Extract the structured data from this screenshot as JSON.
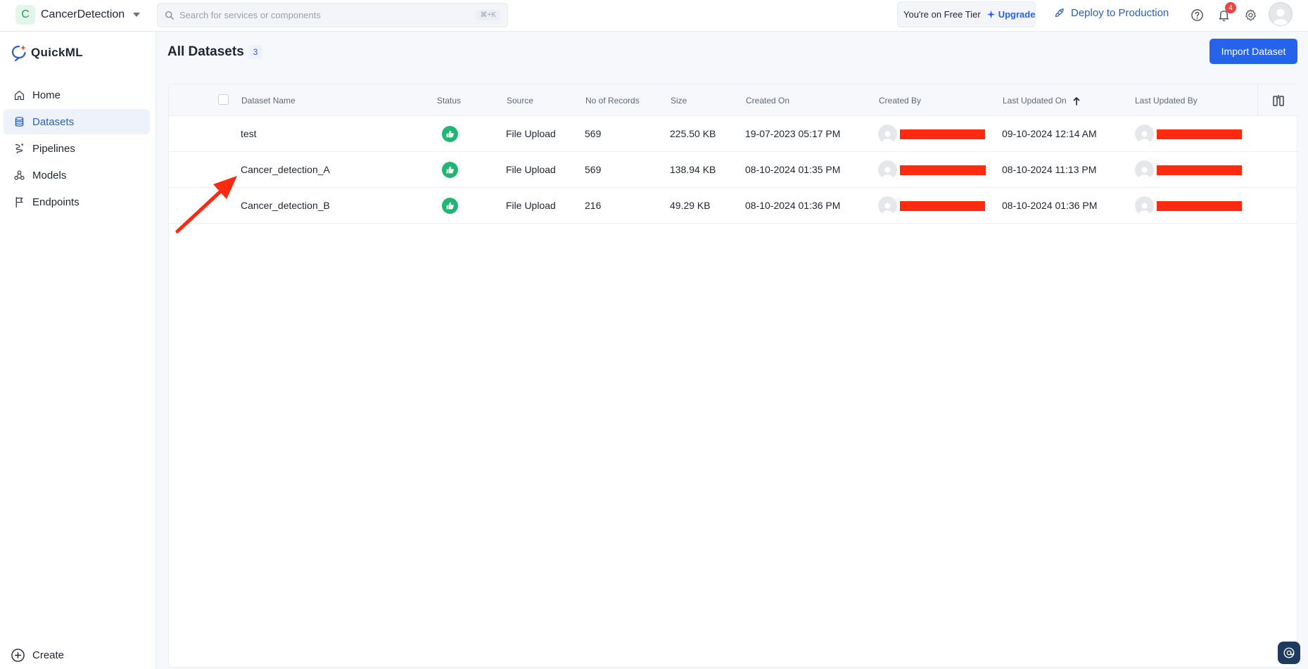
{
  "topbar": {
    "project_initial": "C",
    "project_name": "CancerDetection",
    "search_placeholder": "Search for services or components",
    "search_shortcut": "⌘+K",
    "tier_text": "You're on Free Tier",
    "upgrade_label": "Upgrade",
    "deploy_label": "Deploy to Production",
    "notification_count": "4"
  },
  "sidebar": {
    "brand": "QuickML",
    "items": [
      {
        "label": "Home",
        "icon": "home-icon"
      },
      {
        "label": "Datasets",
        "icon": "database-icon"
      },
      {
        "label": "Pipelines",
        "icon": "pipeline-icon"
      },
      {
        "label": "Models",
        "icon": "models-icon"
      },
      {
        "label": "Endpoints",
        "icon": "flag-icon"
      }
    ],
    "active_item": "Datasets",
    "create_label": "Create"
  },
  "main": {
    "title": "All Datasets",
    "count": "3",
    "import_label": "Import Dataset"
  },
  "table": {
    "headers": {
      "name": "Dataset Name",
      "status": "Status",
      "source": "Source",
      "records": "No of Records",
      "size": "Size",
      "created_on": "Created On",
      "created_by": "Created By",
      "updated_on": "Last Updated On",
      "updated_by": "Last Updated By"
    },
    "sort": {
      "column": "Last Updated On",
      "direction": "ascending"
    },
    "rows": [
      {
        "name": "test",
        "status": "success",
        "source": "File Upload",
        "records": "569",
        "size": "225.50 KB",
        "created_on": "19-07-2023 05:17 PM",
        "updated_on": "09-10-2024 12:14 AM"
      },
      {
        "name": "Cancer_detection_A",
        "status": "success",
        "source": "File Upload",
        "records": "569",
        "size": "138.94 KB",
        "created_on": "08-10-2024 01:35 PM",
        "updated_on": "08-10-2024 11:13 PM"
      },
      {
        "name": "Cancer_detection_B",
        "status": "success",
        "source": "File Upload",
        "records": "216",
        "size": "49.29 KB",
        "created_on": "08-10-2024 01:36 PM",
        "updated_on": "08-10-2024 01:36 PM"
      }
    ]
  },
  "colors": {
    "accent": "#2563eb",
    "status_success": "#22b573",
    "annotation_arrow": "#ff2a10",
    "redaction": "#ff2a10"
  }
}
